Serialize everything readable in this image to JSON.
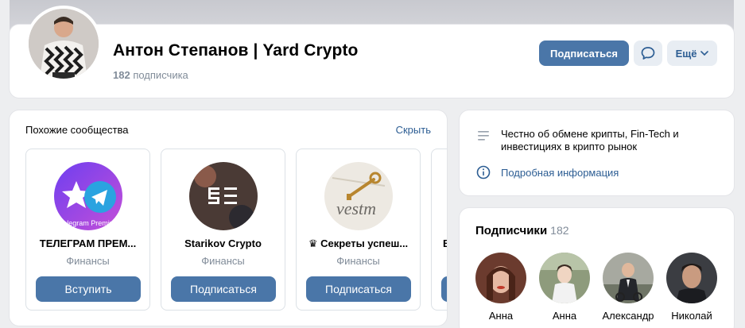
{
  "profile": {
    "name": "Антон Степанов | Yard Crypto",
    "subscribers_count": "182",
    "subscribers_label": "подписчика",
    "subscribe_label": "Подписаться",
    "more_label": "Ещё"
  },
  "similar": {
    "title": "Похожие сообщества",
    "hide_label": "Скрыть",
    "groups": [
      {
        "name": "ТЕЛЕГРАМ ПРЕМ...",
        "category": "Финансы",
        "button": "Вступить",
        "avatar_text": "elegram Premiu"
      },
      {
        "name": "Starikov Crypto",
        "category": "Финансы",
        "button": "Подписаться"
      },
      {
        "name": "♛ Секреты успеш...",
        "category": "Финансы",
        "button": "Подписаться",
        "avatar_text": "vestm"
      },
      {
        "name": "B"
      }
    ]
  },
  "about": {
    "description": "Честно об обмене крипты, Fin-Tech и инвестициях в крипто рынок",
    "details_label": "Подробная информация"
  },
  "subscribers": {
    "title": "Подписчики",
    "count": "182",
    "people": [
      {
        "name": "Анна"
      },
      {
        "name": "Анна"
      },
      {
        "name": "Александр"
      },
      {
        "name": "Николай"
      }
    ]
  },
  "colors": {
    "accent": "#4a76a8",
    "link": "#2c5d93",
    "muted": "#818c99",
    "background": "#edeef0"
  }
}
